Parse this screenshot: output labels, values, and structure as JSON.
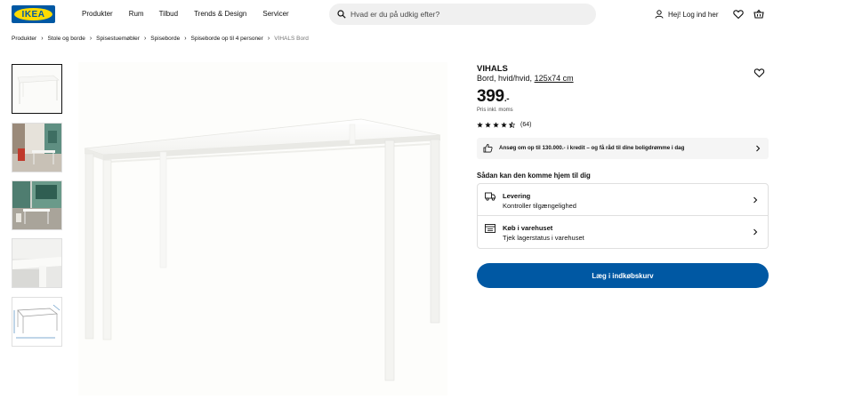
{
  "header": {
    "logo_text": "IKEA",
    "nav": [
      "Produkter",
      "Rum",
      "Tilbud",
      "Trends & Design",
      "Servicer"
    ],
    "search_placeholder": "Hvad er du på udkig efter?",
    "login_label": "Hej! Log ind her",
    "icons": [
      "search-icon",
      "user-icon",
      "heart-icon",
      "cart-icon"
    ]
  },
  "breadcrumb": {
    "items": [
      "Produkter",
      "Stole og borde",
      "Spisestuemøbler",
      "Spiseborde",
      "Spiseborde op til 4 personer",
      "VIHALS Bord"
    ]
  },
  "gallery": {
    "thumbnails": [
      "Bord hvid studio",
      "Bord i stue 1",
      "Bord i stue 2",
      "Bord detalje",
      "Bord mål tegning"
    ],
    "active_index": 0
  },
  "product": {
    "name": "VIHALS",
    "desc": "Bord, hvid/hvid,",
    "size": "125x74 cm",
    "price": "399",
    "price_suffix": ".-",
    "price_note": "Pris inkl. moms",
    "rating_value": 4.5,
    "rating_count": "(64)"
  },
  "credit": {
    "text": "Ansøg om op til 130.000.- i kredit – og få råd til dine boligdrømme i dag"
  },
  "delivery": {
    "heading": "Sådan kan den komme hjem til dig",
    "rows": [
      {
        "title": "Levering",
        "sub": "Kontroller tilgængelighed"
      },
      {
        "title": "Køb i varehuset",
        "sub": "Tjek lagerstatus i varehuset"
      }
    ]
  },
  "cart_button": "Læg i indkøbskurv",
  "colors": {
    "brand_blue": "#0058a3",
    "brand_yellow": "#ffdb00"
  }
}
